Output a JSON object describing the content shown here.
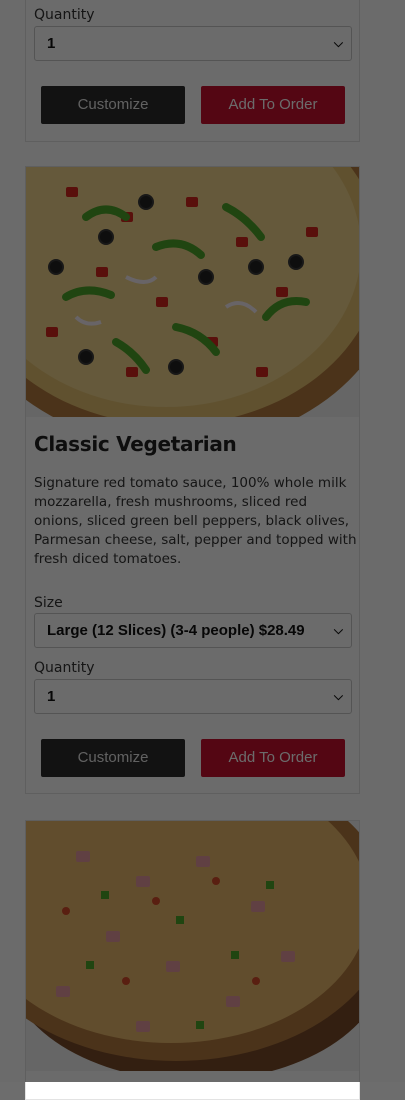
{
  "colors": {
    "customize_bg": "#2b2b2b",
    "add_bg": "#c8102e",
    "overlay": "rgba(0,0,0,0.58)"
  },
  "card_top": {
    "quantity_label": "Quantity",
    "quantity_value": "1",
    "customize_label": "Customize",
    "add_label": "Add To Order"
  },
  "card_vegetarian": {
    "image_icon": "pizza-image",
    "title": "Classic Vegetarian",
    "description": "Signature red tomato sauce, 100% whole milk mozzarella, fresh mushrooms, sliced red onions, sliced green bell peppers, black olives, Parmesan cheese, salt, pepper and topped with fresh diced tomatoes.",
    "size_label": "Size",
    "size_value": "Large (12 Slices) (3-4 people) $28.49",
    "quantity_label": "Quantity",
    "quantity_value": "1",
    "customize_label": "Customize",
    "add_label": "Add To Order"
  },
  "card_bottom": {
    "image_icon": "pizza-image"
  }
}
